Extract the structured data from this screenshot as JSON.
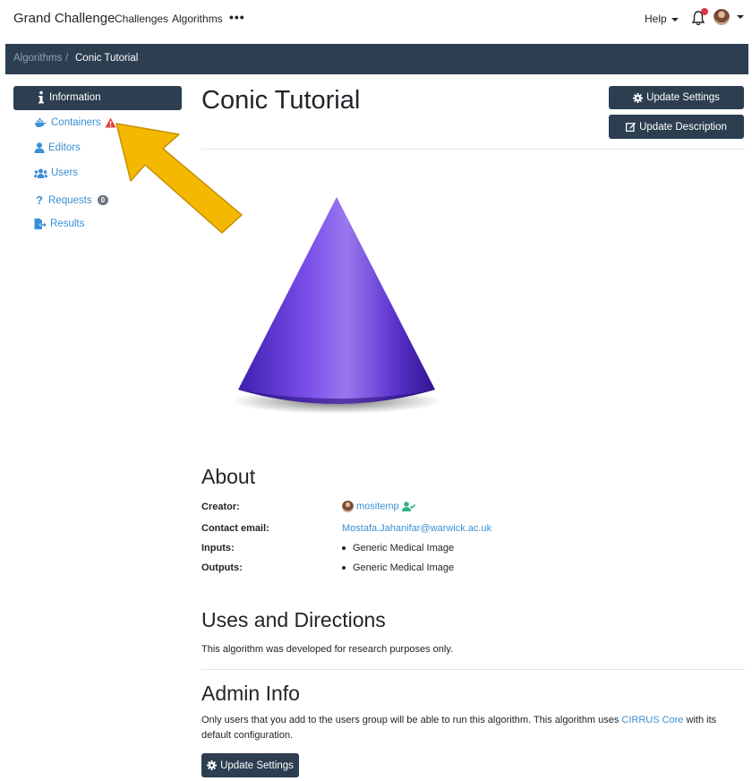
{
  "navbar": {
    "brand": "Grand Challenge",
    "links": [
      "Challenges",
      "Algorithms"
    ],
    "more": "•••",
    "help": "Help"
  },
  "breadcrumb": {
    "parent": "Algorithms",
    "separator": "/",
    "current": "Conic Tutorial"
  },
  "sidebar": {
    "active": "Information",
    "items": [
      {
        "label": "Containers",
        "icon": "docker-icon",
        "warning": true
      },
      {
        "label": "Editors",
        "icon": "user-icon"
      },
      {
        "label": "Users",
        "icon": "users-icon"
      },
      {
        "label": "Requests",
        "icon": "question-icon",
        "badge": "0"
      },
      {
        "label": "Results",
        "icon": "file-export-icon"
      }
    ]
  },
  "page": {
    "title": "Conic Tutorial",
    "update_settings": "Update Settings",
    "update_description": "Update Description"
  },
  "about": {
    "heading": "About",
    "creator_label": "Creator:",
    "creator": "mositemp",
    "contact_label": "Contact email:",
    "contact": "Mostafa.Jahanifar@warwick.ac.uk",
    "inputs_label": "Inputs:",
    "inputs": "Generic Medical Image",
    "outputs_label": "Outputs:",
    "outputs": "Generic Medical Image"
  },
  "uses": {
    "heading": "Uses and Directions",
    "text": "This algorithm was developed for research purposes only."
  },
  "admin": {
    "heading": "Admin Info",
    "text_before": "Only users that you add to the users group will be able to run this algorithm. This algorithm uses ",
    "link": "CIRRUS Core",
    "text_after": " with its default configuration.",
    "button": "Update Settings"
  },
  "colors": {
    "navy": "#2c3e50",
    "link": "#3b8fd4",
    "arrow": "#f5b800",
    "cone": "#6a3fd9"
  }
}
